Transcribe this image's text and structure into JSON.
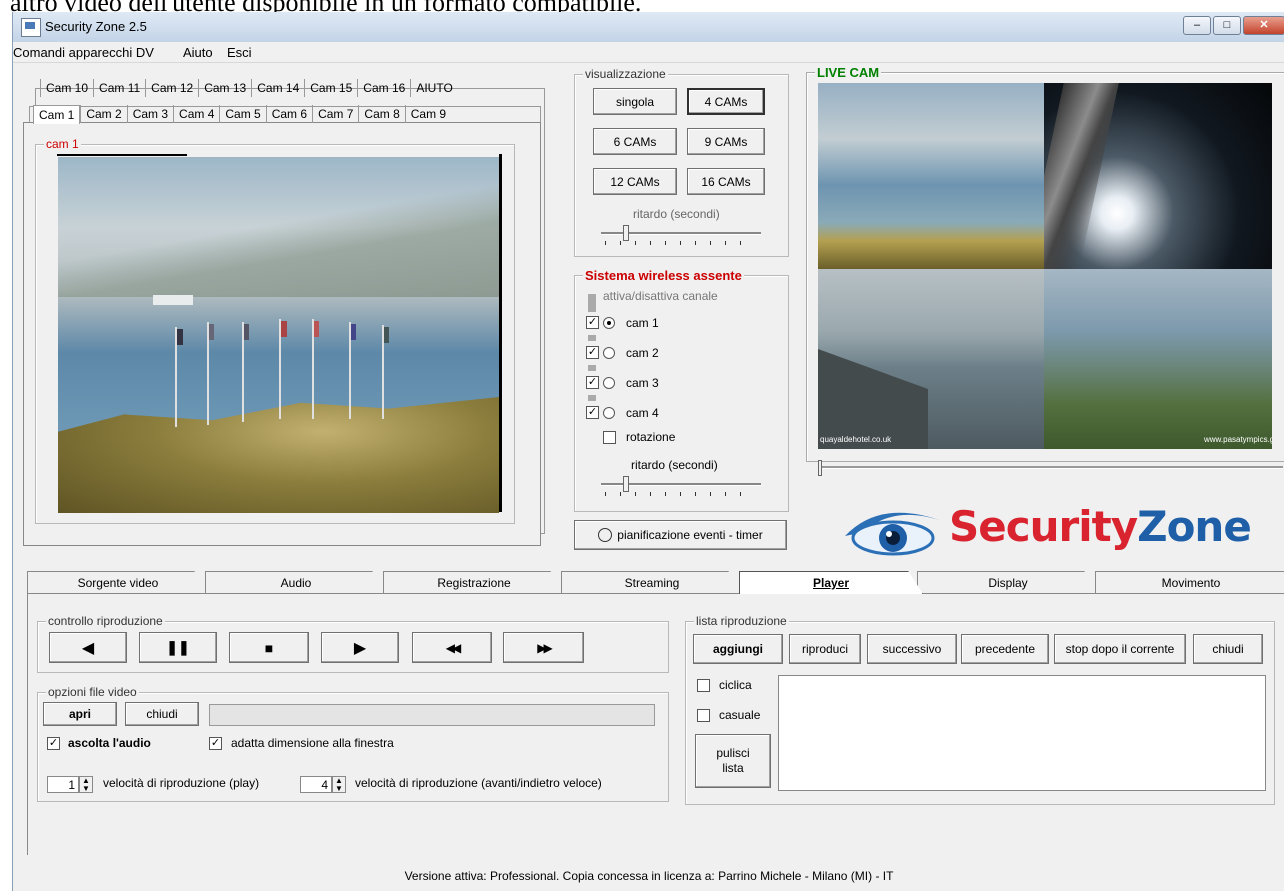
{
  "page_caption_fragment": "altro video dell'utente disponibile in un formato compatibile.",
  "window": {
    "title": "Security Zone 2.5",
    "min": "–",
    "max": "□",
    "close": "✕"
  },
  "menu": [
    "Comandi apparecchi DV",
    "Aiuto",
    "Esci"
  ],
  "cam_tabs_row1": [
    "Cam 10",
    "Cam 11",
    "Cam 12",
    "Cam 13",
    "Cam 14",
    "Cam 15",
    "Cam 16",
    "AIUTO"
  ],
  "cam_tabs_row2": [
    "Cam 1",
    "Cam 2",
    "Cam 3",
    "Cam 4",
    "Cam 5",
    "Cam 6",
    "Cam 7",
    "Cam 8",
    "Cam 9"
  ],
  "cam_view_label": "cam 1",
  "visualizzazione": {
    "label": "visualizzazione",
    "buttons": [
      "singola",
      "4 CAMs",
      "6 CAMs",
      "9 CAMs",
      "12 CAMs",
      "16 CAMs"
    ],
    "selected": "4 CAMs",
    "delay_label": "ritardo (secondi)"
  },
  "wireless": {
    "label": "Sistema wireless assente",
    "toggle_label": "attiva/disattiva canale",
    "channels": [
      {
        "name": "cam 1",
        "checked": true,
        "selected": true
      },
      {
        "name": "cam 2",
        "checked": true,
        "selected": false
      },
      {
        "name": "cam 3",
        "checked": true,
        "selected": false
      },
      {
        "name": "cam 4",
        "checked": true,
        "selected": false
      }
    ],
    "rotation_label": "rotazione",
    "delay_label": "ritardo (secondi)"
  },
  "timer_button": "pianificazione eventi - timer",
  "live_cam": {
    "label": "LIVE CAM",
    "overlay_mid_left": "quayaldehotel.co.uk",
    "overlay_mid_right": "www.pasatympics.gr"
  },
  "logo": {
    "part1": "Security",
    "part2": "Z",
    "part3": "one"
  },
  "main_tabs": [
    "Sorgente video",
    "Audio",
    "Registrazione",
    "Streaming",
    "Player",
    "Display",
    "Movimento"
  ],
  "active_main_tab": "Player",
  "playback_control": {
    "label": "controllo riproduzione",
    "buttons": [
      "◀",
      "❚❚",
      "■",
      "▶",
      "◀◀",
      "▶▶"
    ]
  },
  "file_options": {
    "label": "opzioni file video",
    "open": "apri",
    "close": "chiudi",
    "listen_audio": "ascolta l'audio",
    "fit_window": "adatta dimensione alla finestra",
    "speed_play_value": "1",
    "speed_play_label": "velocità di riproduzione (play)",
    "speed_ff_value": "4",
    "speed_ff_label": "velocità di riproduzione (avanti/indietro veloce)"
  },
  "playlist": {
    "label": "lista riproduzione",
    "buttons": [
      "aggiungi",
      "riproduci",
      "successivo",
      "precedente",
      "stop dopo il corrente",
      "chiudi"
    ],
    "cyclic": "ciclica",
    "random": "casuale",
    "clear_line1": "pulisci",
    "clear_line2": "lista"
  },
  "status_bar": "Versione attiva: Professional. Copia concessa in licenza a: Parrino Michele - Milano (MI) - IT",
  "colors": {
    "red_label": "#cc0000",
    "green_label": "#008000",
    "logo_blue": "#1f5fa8",
    "logo_red": "#d9232e"
  }
}
